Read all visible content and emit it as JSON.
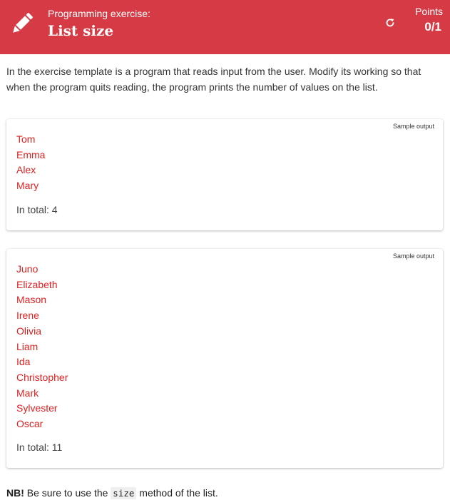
{
  "header": {
    "kicker": "Programming exercise:",
    "title": "List size",
    "points_label": "Points",
    "points_value": "0/1",
    "icons": [
      "pencil-icon",
      "refresh-icon"
    ],
    "color": "#d63b45"
  },
  "intro": "In the exercise template is a program that reads input from the user. Modify its working so that when the program quits reading, the program prints the number of values on the list.",
  "samples": [
    {
      "label": "Sample output",
      "lines": [
        "Tom",
        "Emma",
        "Alex",
        "Mary"
      ],
      "total": "In total: 4"
    },
    {
      "label": "Sample output",
      "lines": [
        "Juno",
        "Elizabeth",
        "Mason",
        "Irene",
        "Olivia",
        "Liam",
        "Ida",
        "Christopher",
        "Mark",
        "Sylvester",
        "Oscar"
      ],
      "total": "In total: 11"
    }
  ],
  "note": {
    "prefix": "NB!",
    "before": " Be sure to use the ",
    "code": "size",
    "after": " method of the list."
  }
}
